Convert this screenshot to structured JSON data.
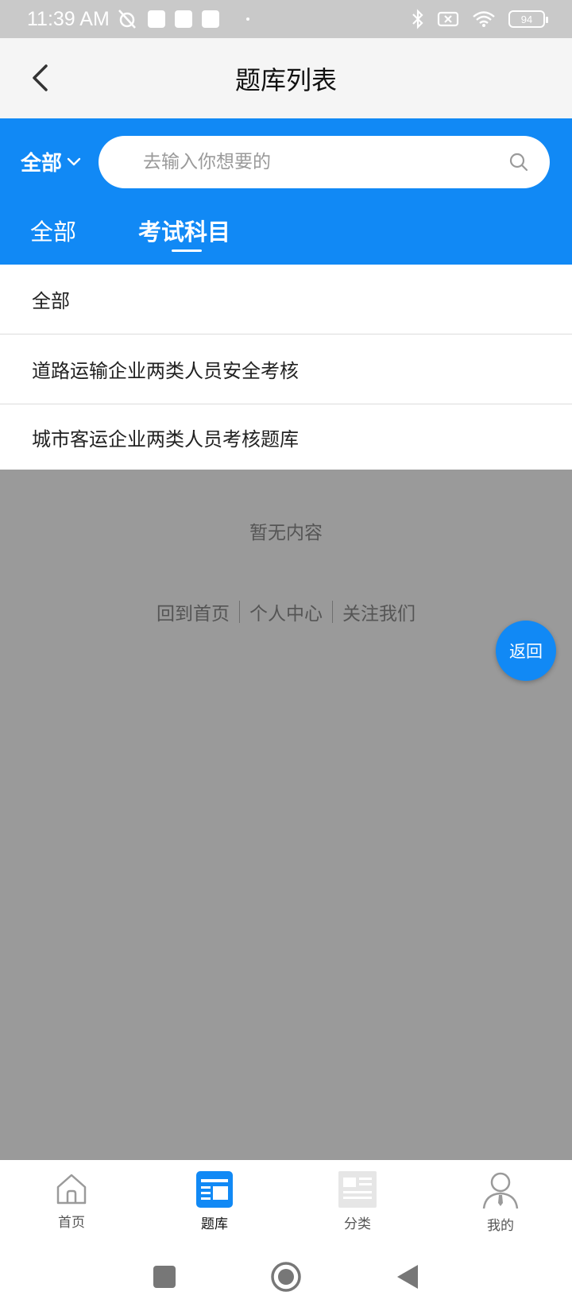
{
  "status_bar": {
    "time": "11:39 AM",
    "battery": "94"
  },
  "header": {
    "title": "题库列表"
  },
  "filter": {
    "label": "全部"
  },
  "search": {
    "placeholder": "去输入你想要的"
  },
  "tabs": [
    {
      "label": "全部",
      "active": false
    },
    {
      "label": "考试科目",
      "active": true
    }
  ],
  "list_items": [
    "全部",
    "道路运输企业两类人员安全考核",
    "城市客运企业两类人员考核题库"
  ],
  "empty_text": "暂无内容",
  "footer_links": [
    "回到首页",
    "个人中心",
    "关注我们"
  ],
  "return_button": "返回",
  "bottom_nav": [
    {
      "label": "首页",
      "icon": "home-icon"
    },
    {
      "label": "题库",
      "icon": "question-bank-icon",
      "active": true
    },
    {
      "label": "分类",
      "icon": "category-icon"
    },
    {
      "label": "我的",
      "icon": "user-icon"
    }
  ],
  "colors": {
    "primary": "#1189f5",
    "overlay": "#9a9a9a"
  }
}
